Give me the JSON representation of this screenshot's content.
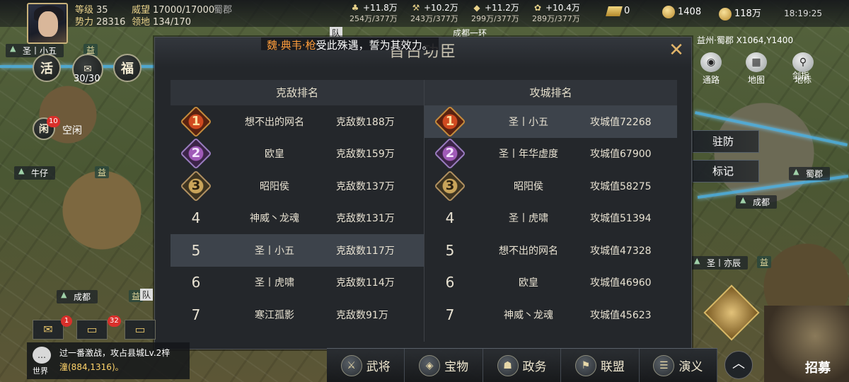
{
  "player": {
    "level_label": "等级",
    "level": "35",
    "power_label": "势力",
    "power": "28316",
    "prestige_label": "威望",
    "prestige": "17000/17000",
    "territory_label": "领地",
    "territory": "134/170",
    "region": "蜀郡",
    "name": "圣丨小五",
    "stamina": "30/30"
  },
  "resources": [
    {
      "icon": "wood-icon",
      "gain": "+11.8万",
      "stock": "254万/377万"
    },
    {
      "icon": "iron-icon",
      "gain": "+10.2万",
      "stock": "243万/377万"
    },
    {
      "icon": "stone-icon",
      "gain": "+11.2万",
      "stock": "299万/377万"
    },
    {
      "icon": "grain-icon",
      "gain": "+10.4万",
      "stock": "289万/377万"
    }
  ],
  "currency": {
    "gold_bar": "0",
    "jade": "1408",
    "copper": "118万"
  },
  "clock": "18:19:25",
  "left_buttons": {
    "huo": "活",
    "fu": "福",
    "xian": "闲",
    "xian_badge": "10",
    "idle": "空闲"
  },
  "map_labels": [
    "圣丨小五",
    "牛仔",
    "成都",
    "成都",
    "圣丨亦辰",
    "蜀郡",
    "益",
    "益",
    "益",
    "益"
  ],
  "map_extra": {
    "team": "队",
    "team2": "队",
    "chengdu_top": "成都一环",
    "jianzhi": "剑指"
  },
  "coord": "益州·蜀郡 X1064,Y1400",
  "right_icons": [
    {
      "icon": "route-icon",
      "label": "通路"
    },
    {
      "icon": "map-icon",
      "label": "地图"
    },
    {
      "icon": "marker-icon",
      "label": "地标"
    }
  ],
  "side_buttons": {
    "garrison": "驻防",
    "mark": "标记"
  },
  "modal": {
    "title": "首占功臣",
    "banner_prefix": "魏",
    "banner_sep1": "·",
    "banner_name": "典韦",
    "banner_sep2": "·",
    "banner_item": "枪",
    "banner_text": "受此殊遇，誓为其效力。",
    "kill_ranking": {
      "header": "克敌排名",
      "rows": [
        {
          "rank": "1",
          "name": "想不出的网名",
          "score": "克敌数188万"
        },
        {
          "rank": "2",
          "name": "欧皇",
          "score": "克敌数159万"
        },
        {
          "rank": "3",
          "name": "昭阳侯",
          "score": "克敌数137万"
        },
        {
          "rank": "4",
          "name": "神威丶龙魂",
          "score": "克敌数131万"
        },
        {
          "rank": "5",
          "name": "圣丨小五",
          "score": "克敌数117万"
        },
        {
          "rank": "6",
          "name": "圣丨虎啸",
          "score": "克敌数114万"
        },
        {
          "rank": "7",
          "name": "寒江孤影",
          "score": "克敌数91万"
        }
      ]
    },
    "siege_ranking": {
      "header": "攻城排名",
      "rows": [
        {
          "rank": "1",
          "name": "圣丨小五",
          "score": "攻城值72268"
        },
        {
          "rank": "2",
          "name": "圣丨年华虚度",
          "score": "攻城值67900"
        },
        {
          "rank": "3",
          "name": "昭阳侯",
          "score": "攻城值58275"
        },
        {
          "rank": "4",
          "name": "圣丨虎啸",
          "score": "攻城值51394"
        },
        {
          "rank": "5",
          "name": "想不出的网名",
          "score": "攻城值47328"
        },
        {
          "rank": "6",
          "name": "欧皇",
          "score": "攻城值46960"
        },
        {
          "rank": "7",
          "name": "神威丶龙魂",
          "score": "攻城值45623"
        }
      ]
    }
  },
  "mail": {
    "badge1": "1",
    "badge2": "32"
  },
  "chat": {
    "channel": "世界",
    "line1": "过一番激战，攻占县城Lv.2梓",
    "line2": "潼(884,1316)。"
  },
  "bottom_nav": [
    {
      "icon": "general-icon",
      "label": "武将"
    },
    {
      "icon": "treasure-icon",
      "label": "宝物"
    },
    {
      "icon": "affairs-icon",
      "label": "政务"
    },
    {
      "icon": "alliance-icon",
      "label": "联盟"
    },
    {
      "icon": "story-icon",
      "label": "演义"
    }
  ],
  "recruit_label": "招募",
  "colors": {
    "accent": "#ff9d3b",
    "rank1": "#d04a20",
    "rank2": "#a05ab8",
    "rank3": "#c9a45a",
    "panel": "#24272b"
  }
}
